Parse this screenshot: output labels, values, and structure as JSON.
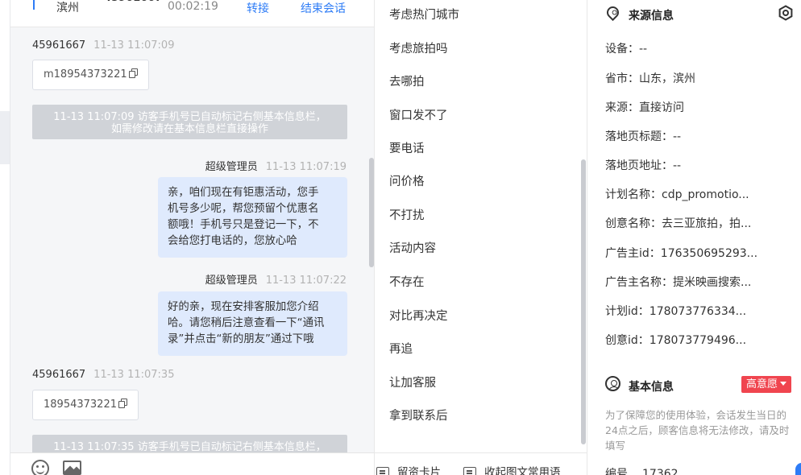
{
  "chat": {
    "header": {
      "city": "滨州",
      "visitor_id": "45961667",
      "timer": "00:02:19",
      "transfer_label": "转接",
      "end_label": "结束会话"
    },
    "messages": [
      {
        "kind": "visitor",
        "sender": "45961667",
        "time": "11-13 11:07:09",
        "phone": "m18954373221"
      },
      {
        "kind": "system",
        "text_line1": "11-13 11:07:09 访客手机号已自动标记右侧基本信息栏，",
        "text_line2": "如需修改请在基本信息栏直接操作"
      },
      {
        "kind": "agent",
        "sender": "超级管理员",
        "time": "11-13 11:07:19",
        "lines": [
          "亲，咱们现在有钜惠活动，您手",
          "机号多少呢，帮您预留个优惠名",
          "额哦！手机号只是登记一下，不",
          "会给您打电话的，您放心哈"
        ]
      },
      {
        "kind": "agent",
        "sender": "超级管理员",
        "time": "11-13 11:07:22",
        "lines": [
          "好的亲，现在安排客服加您介绍",
          "哈。请您稍后注意查看一下“通讯",
          "录”并点击“新的朋友”通过下哦"
        ]
      },
      {
        "kind": "visitor",
        "sender": "45961667",
        "time": "11-13 11:07:35",
        "phone": "18954373221"
      },
      {
        "kind": "system",
        "text_line1": "11-13 11:07:35 访客手机号已自动标记右侧基本信息栏，",
        "text_line2": ""
      }
    ]
  },
  "phrases": {
    "items": [
      "考虑热门城市",
      "考虑旅拍吗",
      "去哪拍",
      "窗口发不了",
      "要电话",
      "问价格",
      "不打扰",
      "活动内容",
      "不存在",
      "对比再决定",
      "再追",
      "让加客服",
      "拿到联系后"
    ],
    "toolbar": {
      "leave_card_label": "留资卡片",
      "collapse_label": "收起图文常用语"
    }
  },
  "info": {
    "source_title": "来源信息",
    "source_rows": [
      {
        "label": "设备：",
        "value": "--"
      },
      {
        "label": "省市：",
        "value": "山东，滨州"
      },
      {
        "label": "来源：",
        "value": "直接访问"
      },
      {
        "label": "落地页标题：",
        "value": "--"
      },
      {
        "label": "落地页地址：",
        "value": "--"
      },
      {
        "label": "计划名称：",
        "value": "cdp_promotio..."
      },
      {
        "label": "创意名称：",
        "value": "去三亚旅拍，拍..."
      },
      {
        "label": "广告主id：",
        "value": "176350695293..."
      },
      {
        "label": "广告主名称：",
        "value": "提米映画搜索..."
      },
      {
        "label": "计划id：",
        "value": "178073776334..."
      },
      {
        "label": "创意id：",
        "value": "178073779496..."
      }
    ],
    "basic_title": "基本信息",
    "intent_badge": "高意愿",
    "notice": "为了保障您的使用体验，会话发生当日的24点之后，顾客信息将无法修改，请及时填写",
    "partial_row": {
      "label": "编号",
      "value": "17362"
    }
  },
  "colors": {
    "accent": "#2e7cf6",
    "agent_bubble": "#dfeafd",
    "badge_red": "#f0454f",
    "system_notice": "#d0d3d8"
  }
}
